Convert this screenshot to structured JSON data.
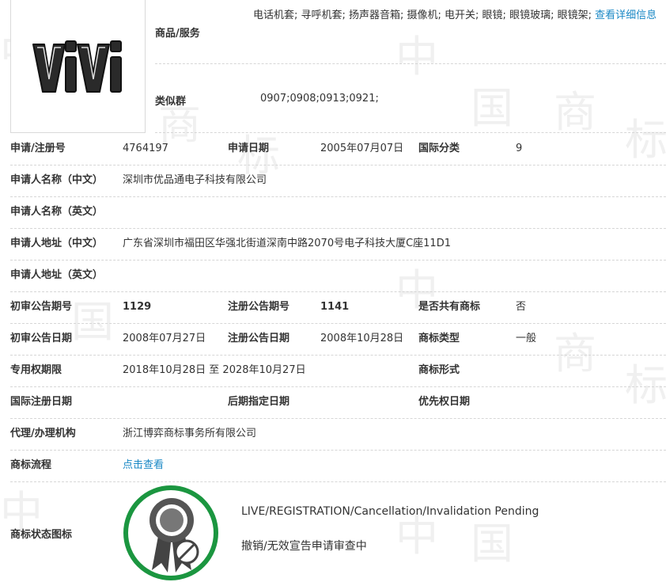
{
  "goods": {
    "label": "商品/服务",
    "text": "电话机套; 寻呼机套; 扬声器音箱; 摄像机; 电开关; 眼镜; 眼镜玻璃; 眼镜架; ",
    "more_link": "查看详细信息"
  },
  "similar_group": {
    "label": "类似群",
    "value": "0907;0908;0913;0921;"
  },
  "logo": {
    "text": "ViVi",
    "icon": "trademark-logo"
  },
  "rows": {
    "reg_no": {
      "label": "申请/注册号",
      "value": "4764197"
    },
    "apply_date": {
      "label": "申请日期",
      "value": "2005年07月07日"
    },
    "intl_class": {
      "label": "国际分类",
      "value": "9"
    },
    "applicant_cn": {
      "label": "申请人名称（中文）",
      "value": "深圳市优品通电子科技有限公司"
    },
    "applicant_en": {
      "label": "申请人名称（英文）",
      "value": ""
    },
    "address_cn": {
      "label": "申请人地址（中文）",
      "value": "广东省深圳市福田区华强北街道深南中路2070号电子科技大厦C座11D1"
    },
    "address_en": {
      "label": "申请人地址（英文）",
      "value": ""
    },
    "prelim_no": {
      "label": "初审公告期号",
      "value": "1129"
    },
    "reg_pub_no": {
      "label": "注册公告期号",
      "value": "1141"
    },
    "shared": {
      "label": "是否共有商标",
      "value": "否"
    },
    "prelim_date": {
      "label": "初审公告日期",
      "value": "2008年07月27日"
    },
    "reg_pub_date": {
      "label": "注册公告日期",
      "value": "2008年10月28日"
    },
    "tm_type": {
      "label": "商标类型",
      "value": "一般"
    },
    "exclusive": {
      "label": "专用权期限",
      "value": "2018年10月28日 至 2028年10月27日"
    },
    "tm_form": {
      "label": "商标形式",
      "value": ""
    },
    "intl_reg_date": {
      "label": "国际注册日期",
      "value": ""
    },
    "later_date": {
      "label": "后期指定日期",
      "value": ""
    },
    "priority_date": {
      "label": "优先权日期",
      "value": ""
    },
    "agent": {
      "label": "代理/办理机构",
      "value": "浙江博弈商标事务所有限公司"
    },
    "process": {
      "label": "商标流程",
      "value": "点击查看"
    }
  },
  "status": {
    "label": "商标状态图标",
    "en": "LIVE/REGISTRATION/Cancellation/Invalidation Pending",
    "cn": "撤销/无效宣告申请审查中",
    "icon": "registration-status-seal-icon",
    "ring_color": "#1b9640"
  },
  "colors": {
    "link": "#1a88c5",
    "divider": "#d6d6d6"
  }
}
